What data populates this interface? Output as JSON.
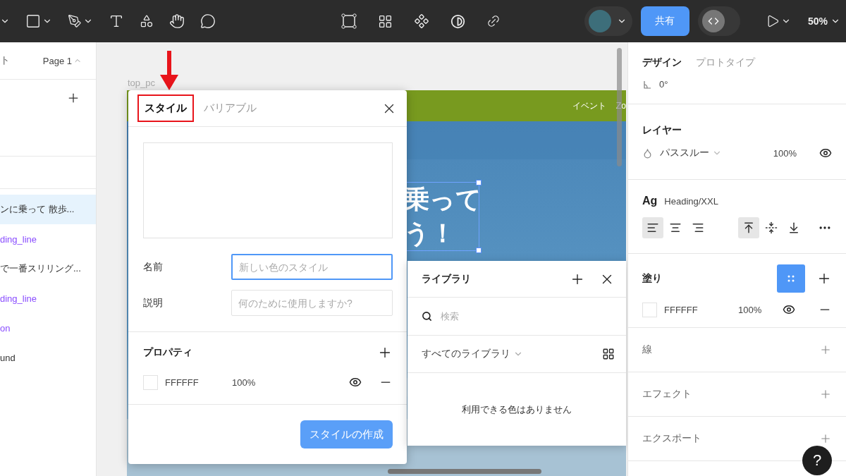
{
  "toolbar": {
    "share_button": "共有",
    "zoom": "50%"
  },
  "left_panel": {
    "tab_fragment": "ト",
    "page": "Page 1",
    "layers": [
      {
        "name": "ンに乗って 散歩...",
        "kind": "text",
        "selected": true
      },
      {
        "name": "ding_line",
        "kind": "instance",
        "selected": false
      },
      {
        "name": "で一番スリリング...",
        "kind": "text",
        "selected": false
      },
      {
        "name": "ding_line",
        "kind": "instance",
        "selected": false
      },
      {
        "name": "on",
        "kind": "instance",
        "selected": false
      },
      {
        "name": "und",
        "kind": "text",
        "selected": false
      }
    ]
  },
  "canvas": {
    "frame_label": "top_pc",
    "nav_items": [
      "イベント",
      "Zo"
    ],
    "hero_lines": [
      "乗って",
      "う！"
    ]
  },
  "style_dialog": {
    "tabs": [
      {
        "label": "スタイル",
        "selected": true,
        "highlighted": true
      },
      {
        "label": "バリアブル",
        "selected": false,
        "highlighted": false
      }
    ],
    "fields": [
      {
        "label": "名前",
        "placeholder": "新しい色のスタイル",
        "focused": true
      },
      {
        "label": "説明",
        "placeholder": "何のために使用しますか?",
        "focused": false
      }
    ],
    "properties_title": "プロパティ",
    "property": {
      "hex": "FFFFFF",
      "opacity": "100%"
    },
    "create_button": "スタイルの作成"
  },
  "library": {
    "title": "ライブラリ",
    "search_placeholder": "検索",
    "filter": "すべてのライブラリ",
    "empty": "利用できる色はありません"
  },
  "right_panel": {
    "tabs": [
      {
        "label": "デザイン",
        "selected": true
      },
      {
        "label": "プロトタイプ",
        "selected": false
      }
    ],
    "rotation": "0°",
    "layer": {
      "title": "レイヤー",
      "blend": "パススルー",
      "opacity": "100%"
    },
    "text": {
      "style_label": "Ag",
      "style_name": "Heading/XXL",
      "align_buttons": [
        {
          "kind": "left",
          "selected": true
        },
        {
          "kind": "center",
          "selected": false
        },
        {
          "kind": "right",
          "selected": false
        },
        {
          "kind": "top",
          "selected": true
        },
        {
          "kind": "middle",
          "selected": false
        },
        {
          "kind": "bottom",
          "selected": false
        }
      ]
    },
    "fill": {
      "title": "塗り",
      "hex": "FFFFFF",
      "opacity": "100%"
    },
    "sections": [
      "線",
      "エフェクト",
      "エクスポート"
    ],
    "help": "?"
  }
}
